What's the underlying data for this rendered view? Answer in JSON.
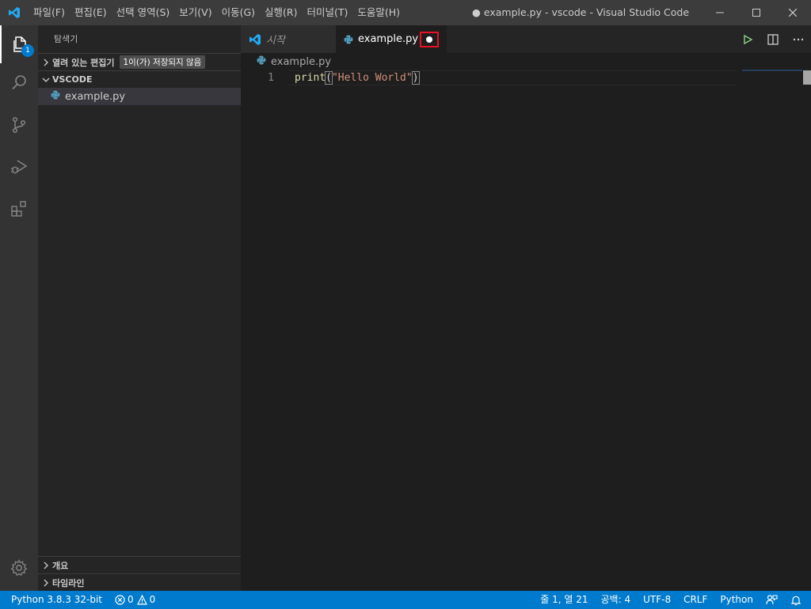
{
  "window": {
    "title": "● example.py - vscode - Visual Studio Code"
  },
  "menu": [
    "파일(F)",
    "편집(E)",
    "선택 영역(S)",
    "보기(V)",
    "이동(G)",
    "실행(R)",
    "터미널(T)",
    "도움말(H)"
  ],
  "activity_bar": {
    "explorer_badge": "1"
  },
  "sidebar": {
    "title": "탐색기",
    "open_editors": {
      "label": "열려 있는 편집기",
      "badge": "1이(가) 저장되지 않음"
    },
    "folder": {
      "label": "VSCODE",
      "files": [
        {
          "name": "example.py"
        }
      ]
    },
    "outline_label": "개요",
    "timeline_label": "타임라인"
  },
  "editor": {
    "tabs": [
      {
        "label": "시작",
        "active": false
      },
      {
        "label": "example.py",
        "active": true,
        "dirty": true
      }
    ],
    "breadcrumb": "example.py",
    "lines": [
      {
        "number": "1",
        "fn": "print",
        "open": "(",
        "str": "\"Hello World\"",
        "close": ")"
      }
    ]
  },
  "status_bar": {
    "interpreter": "Python 3.8.3 32-bit",
    "errors": "0",
    "warnings": "0",
    "position": "줄 1, 열 21",
    "spaces": "공백: 4",
    "encoding": "UTF-8",
    "eol": "CRLF",
    "language": "Python"
  },
  "colors": {
    "accent": "#007acc",
    "dirty_highlight": "#e81123",
    "python_icon": "#519aba"
  }
}
